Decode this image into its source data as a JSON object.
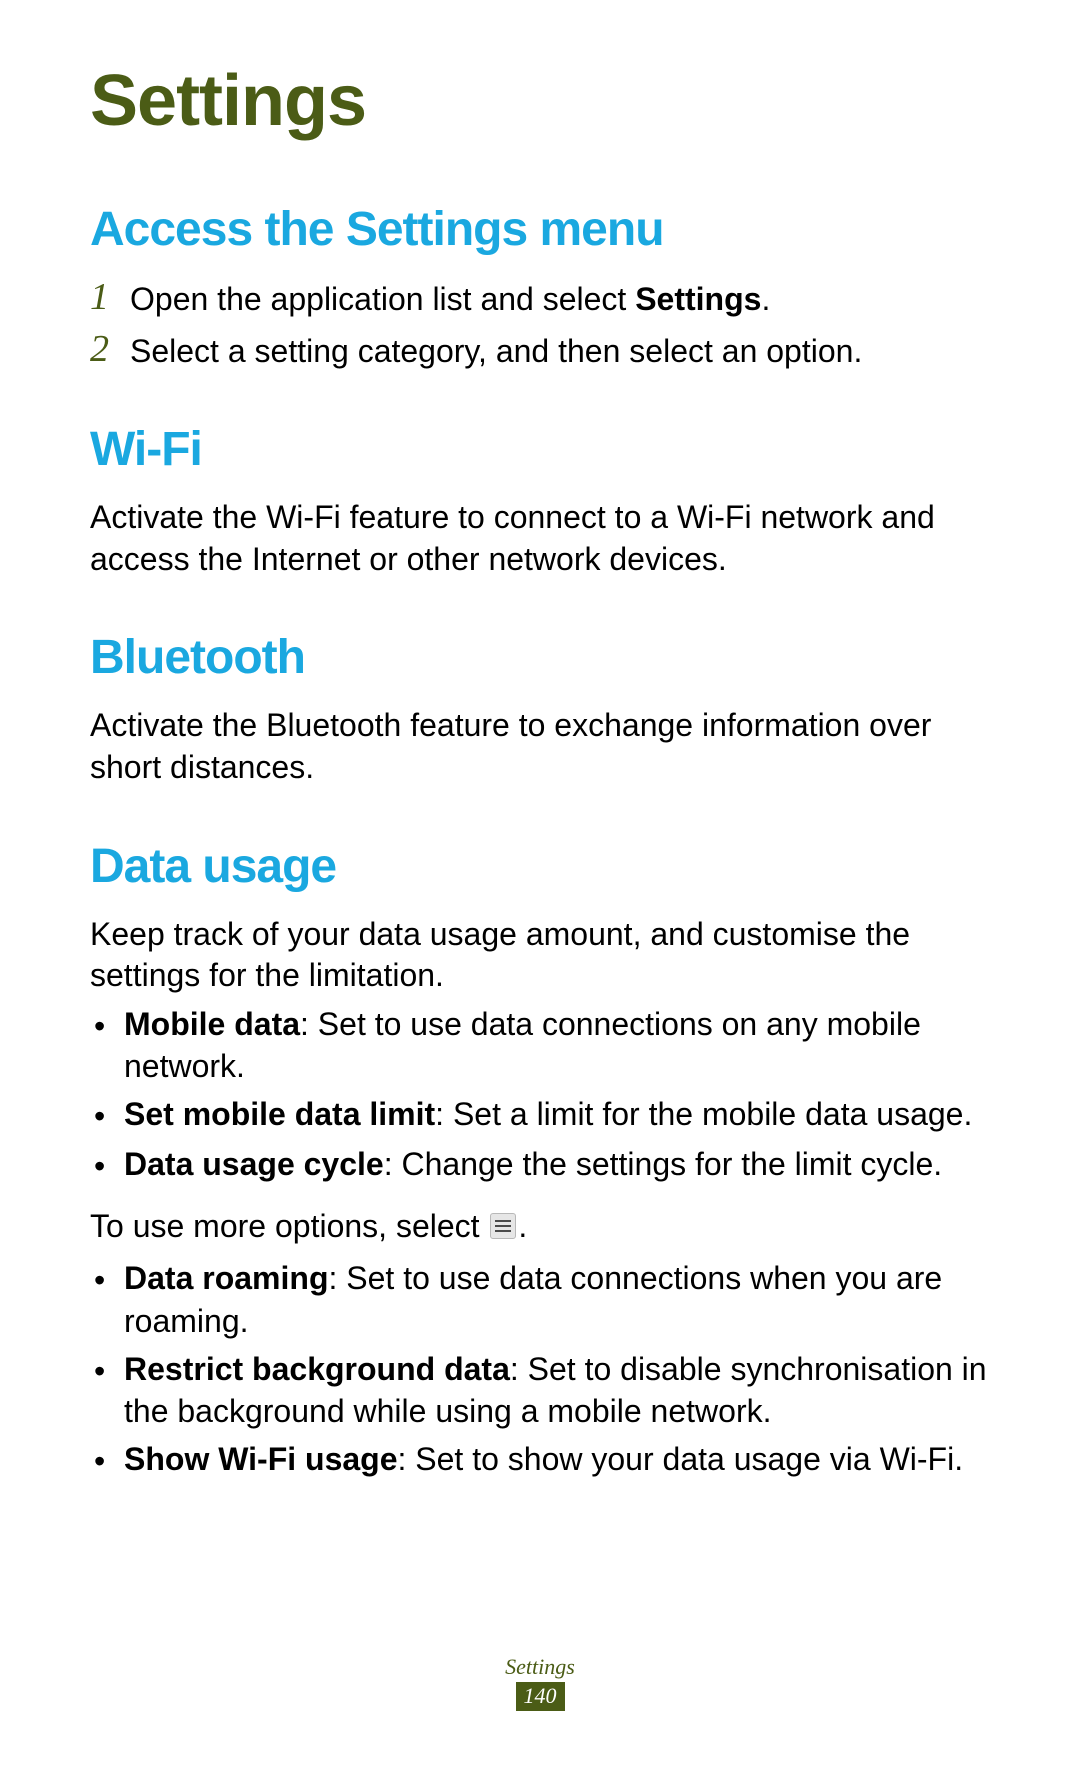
{
  "chapter_title": "Settings",
  "sections": {
    "access": {
      "title": "Access the Settings menu",
      "steps": [
        {
          "num": "1",
          "prefix": "Open the application list and select ",
          "bold": "Settings",
          "suffix": "."
        },
        {
          "num": "2",
          "prefix": "Select a setting category, and then select an option.",
          "bold": "",
          "suffix": ""
        }
      ]
    },
    "wifi": {
      "title": "Wi-Fi",
      "body": "Activate the Wi-Fi feature to connect to a Wi-Fi network and access the Internet or other network devices."
    },
    "bluetooth": {
      "title": "Bluetooth",
      "body": "Activate the Bluetooth feature to exchange information over short distances."
    },
    "data_usage": {
      "title": "Data usage",
      "intro": "Keep track of your data usage amount, and customise the settings for the limitation.",
      "bullets1": [
        {
          "bold": "Mobile data",
          "rest": ": Set to use data connections on any mobile network."
        },
        {
          "bold": "Set mobile data limit",
          "rest": ": Set a limit for the mobile data usage."
        },
        {
          "bold": "Data usage cycle",
          "rest": ": Change the settings for the limit cycle."
        }
      ],
      "more_options_pre": "To use more options, select ",
      "more_options_post": ".",
      "bullets2": [
        {
          "bold": "Data roaming",
          "rest": ": Set to use data connections when you are roaming."
        },
        {
          "bold": "Restrict background data",
          "rest": ": Set to disable synchronisation in the background while using a mobile network."
        },
        {
          "bold": "Show Wi-Fi usage",
          "rest": ": Set to show your data usage via Wi-Fi."
        }
      ]
    }
  },
  "footer": {
    "label": "Settings",
    "page": "140"
  }
}
